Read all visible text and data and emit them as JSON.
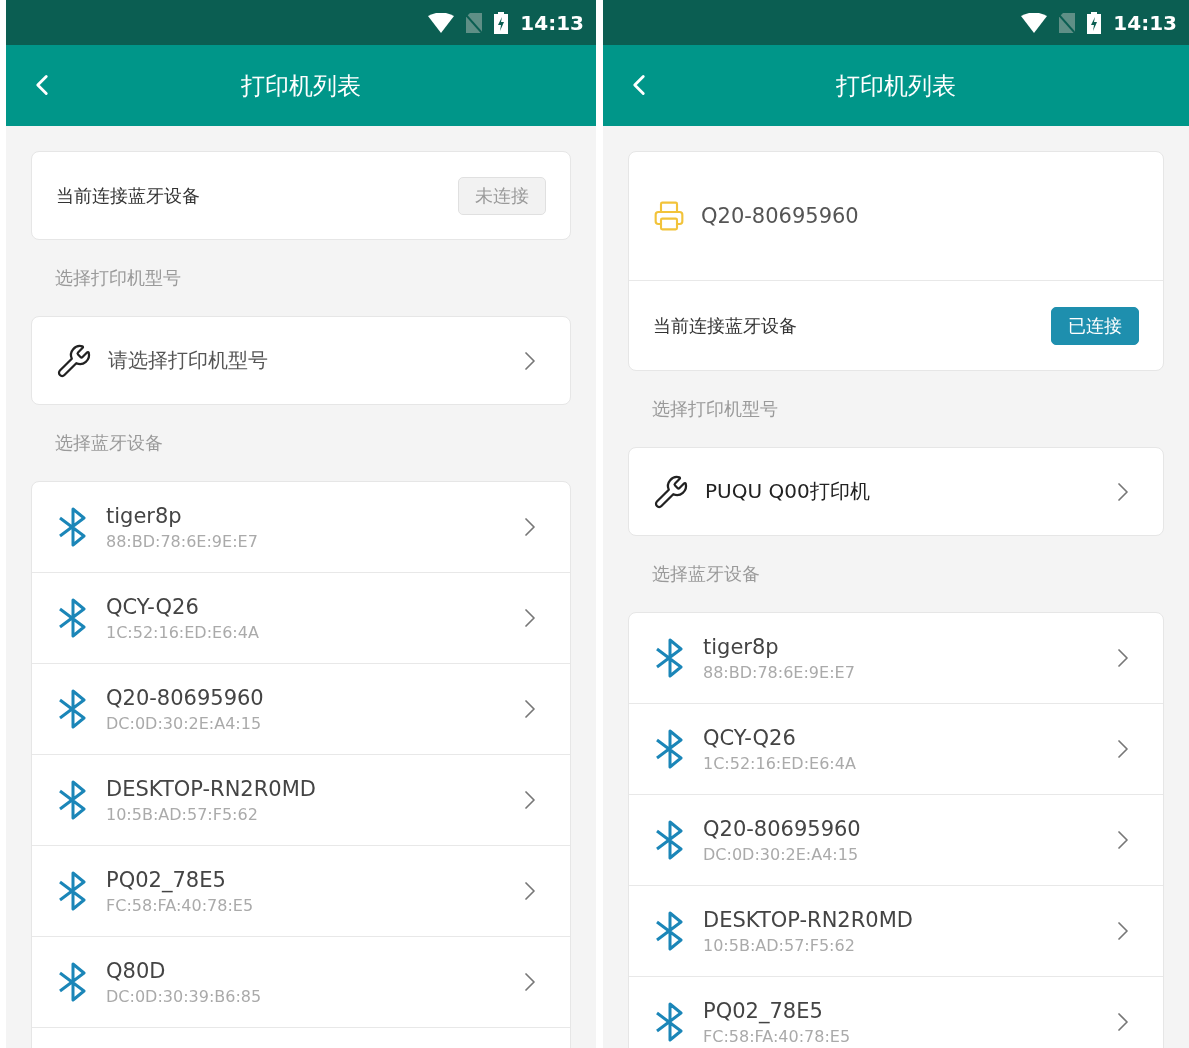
{
  "screens": [
    {
      "status_bar": {
        "time": "14:13"
      },
      "header": {
        "title": "打印机列表"
      },
      "connection": {
        "label": "当前连接蓝牙设备",
        "status": "未连接",
        "connected": false
      },
      "model_section": {
        "heading": "选择打印机型号",
        "value": "请选择打印机型号",
        "chosen": false
      },
      "devices_section": {
        "heading": "选择蓝牙设备",
        "devices": [
          {
            "name": "tiger8p",
            "address": "88:BD:78:6E:9E:E7"
          },
          {
            "name": "QCY-Q26",
            "address": "1C:52:16:ED:E6:4A"
          },
          {
            "name": "Q20-80695960",
            "address": "DC:0D:30:2E:A4:15"
          },
          {
            "name": "DESKTOP-RN2R0MD",
            "address": "10:5B:AD:57:F5:62"
          },
          {
            "name": "PQ02_78E5",
            "address": "FC:58:FA:40:78:E5"
          },
          {
            "name": "Q80D",
            "address": "DC:0D:30:39:B6:85"
          }
        ]
      }
    },
    {
      "status_bar": {
        "time": "14:13"
      },
      "header": {
        "title": "打印机列表"
      },
      "connected_printer": {
        "name": "Q20-80695960"
      },
      "connection": {
        "label": "当前连接蓝牙设备",
        "status": "已连接",
        "connected": true
      },
      "model_section": {
        "heading": "选择打印机型号",
        "value": "PUQU Q00打印机",
        "chosen": true
      },
      "devices_section": {
        "heading": "选择蓝牙设备",
        "devices": [
          {
            "name": "tiger8p",
            "address": "88:BD:78:6E:9E:E7"
          },
          {
            "name": "QCY-Q26",
            "address": "1C:52:16:ED:E6:4A"
          },
          {
            "name": "Q20-80695960",
            "address": "DC:0D:30:2E:A4:15"
          },
          {
            "name": "DESKTOP-RN2R0MD",
            "address": "10:5B:AD:57:F5:62"
          },
          {
            "name": "PQ02_78E5",
            "address": "FC:58:FA:40:78:E5"
          }
        ]
      }
    }
  ]
}
